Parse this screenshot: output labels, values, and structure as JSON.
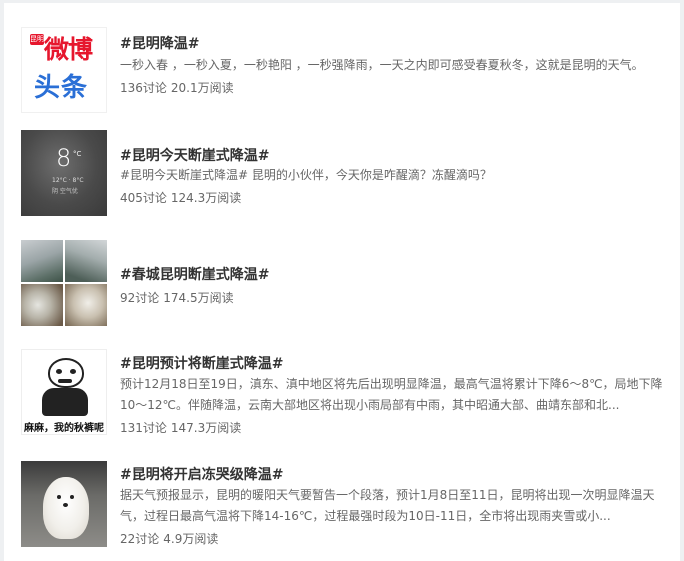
{
  "items": [
    {
      "title": "#昆明降温#",
      "desc": "一秒入春 ，一秒入夏，一秒艳阳 ，一秒强降雨，一天之内即可感受春夏秋冬，这就是昆明的天气。",
      "discuss": "136讨论",
      "reads": "20.1万阅读",
      "thumb": {
        "type": "logo",
        "tag": "昆明",
        "line1": "微博",
        "line2": "头条"
      }
    },
    {
      "title": "#昆明今天断崖式降温#",
      "desc": "#昆明今天断崖式降温# 昆明的小伙伴，今天你是咋醒滴？冻醒滴吗？",
      "discuss": "405讨论",
      "reads": "124.3万阅读",
      "thumb": {
        "type": "weather",
        "temp": "8",
        "unit": "°C",
        "line1": "12°C · 8°C",
        "line2": "阴  空气优"
      }
    },
    {
      "title": "#春城昆明断崖式降温#",
      "desc": "",
      "discuss": "92讨论",
      "reads": "174.5万阅读",
      "thumb": {
        "type": "collage"
      }
    },
    {
      "title": "#昆明预计将断崖式降温#",
      "desc": "预计12月18日至19日，滇东、滇中地区将先后出现明显降温，最高气温将累计下降6～8℃，局地下降10～12℃。伴随降温，云南大部地区将出现小雨局部有中雨，其中昭通大部、曲靖东部和北...",
      "discuss": "131讨论",
      "reads": "147.3万阅读",
      "thumb": {
        "type": "meme",
        "caption": "麻麻，我的秋裤呢"
      }
    },
    {
      "title": "#昆明将开启冻哭级降温#",
      "desc": "据天气预报显示，昆明的暖阳天气要暂告一个段落，预计1月8日至11日，昆明将出现一次明显降温天气，过程日最高气温将下降14-16℃，过程最强时段为10日-11日，全市将出现雨夹雪或小...",
      "discuss": "22讨论",
      "reads": "4.9万阅读",
      "thumb": {
        "type": "dog"
      }
    }
  ]
}
